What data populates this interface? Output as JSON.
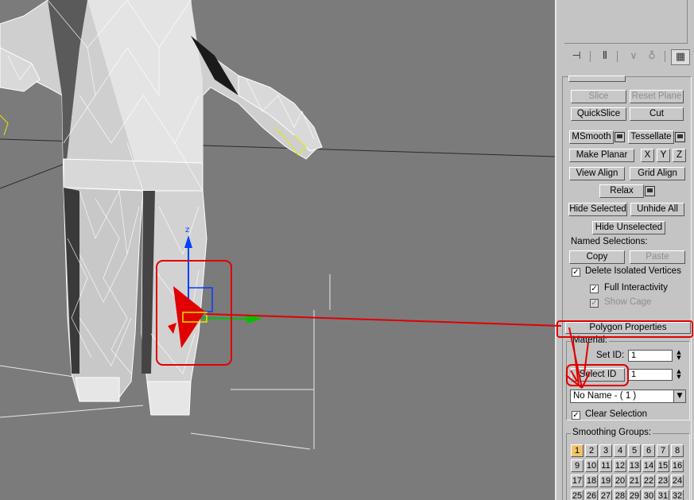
{
  "viewport": {
    "axis_z_label": "z",
    "mesh": "white wireframe character model with red sub-object gizmo"
  },
  "command_panel": {
    "icons": [
      "pin-stack-icon",
      "show-end-result-icon",
      "make-unique-icon",
      "remove-modifier-icon",
      "configure-modifier-sets-icon"
    ],
    "buttons": {
      "slice": "Slice",
      "reset_plane": "Reset Plane",
      "quickslice": "QuickSlice",
      "cut": "Cut",
      "msmooth": "MSmooth",
      "tessellate": "Tessellate",
      "make_planar": "Make Planar",
      "x": "X",
      "y": "Y",
      "z": "Z",
      "view_align": "View Align",
      "grid_align": "Grid Align",
      "relax": "Relax",
      "hide_selected": "Hide Selected",
      "unhide_all": "Unhide All",
      "hide_unselected": "Hide Unselected",
      "copy": "Copy",
      "paste": "Paste"
    },
    "named_selections_label": "Named Selections:",
    "checkboxes": {
      "delete_isolated": {
        "label": "Delete Isolated Vertices",
        "mark": "✓"
      },
      "full_interactivity": {
        "label": "Full Interactivity",
        "mark": "✓"
      },
      "show_cage": {
        "label": "Show Cage",
        "mark": "✓"
      },
      "clear_selection": {
        "label": "Clear Selection",
        "mark": "✓"
      }
    },
    "polygon_properties": {
      "title": "Polygon Properties",
      "material_label": "Material:",
      "set_id_label": "Set ID:",
      "set_id_value": "1",
      "select_id_label": "Select ID",
      "select_id_value": "1",
      "material_name": "No Name - ( 1 )"
    },
    "smoothing_groups": {
      "label": "Smoothing Groups:",
      "buttons": [
        "1",
        "2",
        "3",
        "4",
        "5",
        "6",
        "7",
        "8",
        "9",
        "10",
        "11",
        "12",
        "13",
        "14",
        "15",
        "16",
        "17",
        "18",
        "19",
        "20",
        "21",
        "22",
        "23",
        "24",
        "25",
        "26",
        "27",
        "28",
        "29",
        "30",
        "31",
        "32"
      ],
      "active": [
        "1"
      ]
    }
  },
  "colors": {
    "viewport_bg": "#7b7b7b",
    "panel_bg": "#c4c4c4",
    "annotation_red": "#e00000",
    "smoothing_active": "#f2c46c"
  }
}
